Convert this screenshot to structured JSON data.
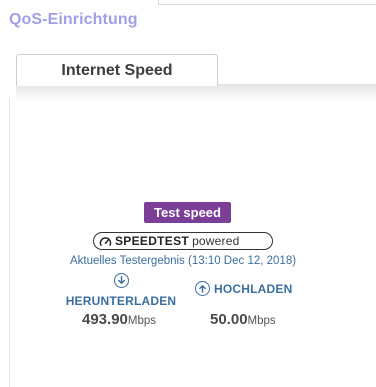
{
  "page": {
    "title": "QoS-Einrichtung"
  },
  "tabs": [
    {
      "label": "Internet Speed",
      "active": true
    }
  ],
  "test": {
    "button_label": "Test speed",
    "button_color": "#7b3f98",
    "logo": {
      "brand": "SPEEDTEST",
      "suffix": "powered",
      "icon": "gauge-icon"
    },
    "last_result": "Aktuelles Testergebnis (13:10 Dec 12, 2018)"
  },
  "download": {
    "label": "HERUNTERLADEN",
    "icon": "arrow-down-circle-icon",
    "value": "493.90",
    "unit": "Mbps"
  },
  "upload": {
    "label": "HOCHLADEN",
    "icon": "arrow-up-circle-icon",
    "value": "50.00",
    "unit": "Mbps"
  },
  "colors": {
    "title": "#a49ee6",
    "link": "#3b6ea0",
    "accent": "#7b3f98"
  }
}
